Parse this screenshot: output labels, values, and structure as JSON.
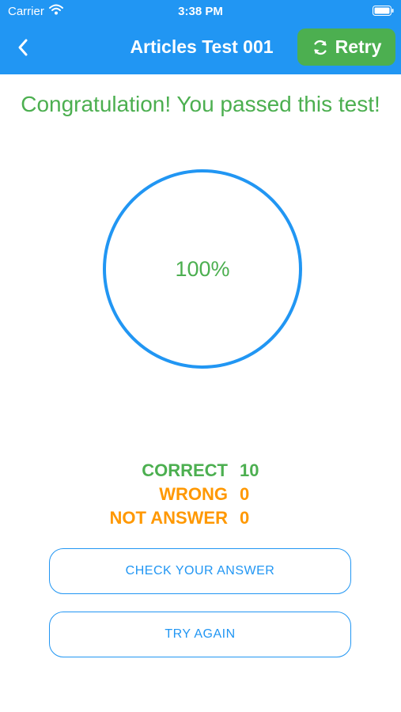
{
  "status_bar": {
    "carrier": "Carrier",
    "time": "3:38 PM",
    "wifi_icon": "wifi-icon",
    "battery_icon": "battery-icon"
  },
  "header": {
    "title": "Articles Test 001",
    "back_icon": "chevron-left-icon",
    "retry_label": "Retry",
    "retry_icon": "refresh-icon"
  },
  "result": {
    "message": "Congratulation! You passed this test!",
    "percent": "100%"
  },
  "stats": {
    "correct_label": "CORRECT",
    "correct_value": "10",
    "wrong_label": "WRONG",
    "wrong_value": "0",
    "not_answer_label": "NOT ANSWER",
    "not_answer_value": "0"
  },
  "buttons": {
    "check_answer": "CHECK YOUR ANSWER",
    "try_again": "TRY AGAIN"
  },
  "colors": {
    "primary": "#2196F3",
    "success": "#4CAF50",
    "warning": "#FF9800"
  }
}
